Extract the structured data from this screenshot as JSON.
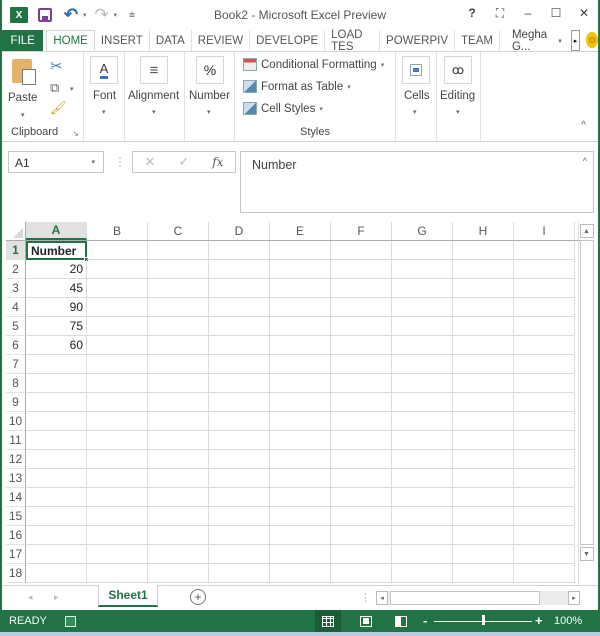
{
  "window": {
    "title": "Book2 - Microsoft Excel Preview",
    "app_icon": "excel-icon",
    "quick_access": [
      "save-icon",
      "undo-icon",
      "redo-icon",
      "customize-qat-icon"
    ],
    "controls": {
      "help": "?",
      "restore_ribbon": "⛶",
      "minimize": "–",
      "maximize": "☐",
      "close": "✕"
    }
  },
  "tabs": {
    "file": "FILE",
    "items": [
      {
        "label": "HOME",
        "active": true
      },
      {
        "label": "INSERT",
        "active": false
      },
      {
        "label": "DATA",
        "active": false
      },
      {
        "label": "REVIEW",
        "active": false
      },
      {
        "label": "DEVELOPE",
        "active": false
      },
      {
        "label": "LOAD TES",
        "active": false
      },
      {
        "label": "POWERPIV",
        "active": false
      },
      {
        "label": "TEAM",
        "active": false
      }
    ],
    "user": "Megha G...",
    "scroll_right": "▸",
    "feedback_icon": "smiley-icon"
  },
  "ribbon": {
    "clipboard": {
      "paste": "Paste",
      "group_label": "Clipboard",
      "launcher": "↘"
    },
    "font": {
      "label": "Font",
      "icon_glyph": "A"
    },
    "alignment": {
      "label": "Alignment",
      "icon_glyph": "≡"
    },
    "number": {
      "label": "Number",
      "icon_glyph": "%"
    },
    "styles": {
      "conditional_formatting": "Conditional Formatting",
      "format_as_table": "Format as Table",
      "cell_styles": "Cell Styles",
      "group_label": "Styles"
    },
    "cells": {
      "label": "Cells"
    },
    "editing": {
      "label": "Editing"
    },
    "collapse": "^",
    "caret": "▾"
  },
  "formula_bar": {
    "name_box": "A1",
    "cancel": "✕",
    "enter": "✓",
    "fx": "fx",
    "formula": "Number",
    "expand": "^",
    "dots": "⋮"
  },
  "sheet": {
    "columns": [
      "A",
      "B",
      "C",
      "D",
      "E",
      "F",
      "G",
      "H",
      "I"
    ],
    "selected_column": "A",
    "selected_row": 1,
    "active_cell": "A1",
    "rows": [
      {
        "n": "1",
        "A": "Number"
      },
      {
        "n": "2",
        "A": "20"
      },
      {
        "n": "3",
        "A": "45"
      },
      {
        "n": "4",
        "A": "90"
      },
      {
        "n": "5",
        "A": "75"
      },
      {
        "n": "6",
        "A": "60"
      },
      {
        "n": "7",
        "A": ""
      },
      {
        "n": "8",
        "A": ""
      },
      {
        "n": "9",
        "A": ""
      },
      {
        "n": "10",
        "A": ""
      },
      {
        "n": "11",
        "A": ""
      },
      {
        "n": "12",
        "A": ""
      },
      {
        "n": "13",
        "A": ""
      },
      {
        "n": "14",
        "A": ""
      },
      {
        "n": "15",
        "A": ""
      },
      {
        "n": "16",
        "A": ""
      },
      {
        "n": "17",
        "A": ""
      },
      {
        "n": "18",
        "A": ""
      }
    ]
  },
  "sheet_tabs": {
    "prev": "◂",
    "next": "▸",
    "tabs": [
      "Sheet1"
    ],
    "add": "+"
  },
  "status_bar": {
    "mode": "READY",
    "views": [
      "normal-view",
      "page-layout-view",
      "page-break-view"
    ],
    "zoom_minus": "-",
    "zoom_plus": "+",
    "zoom_level": "100%",
    "zoom_fraction": 0.5
  },
  "colors": {
    "accent": "#217346"
  }
}
